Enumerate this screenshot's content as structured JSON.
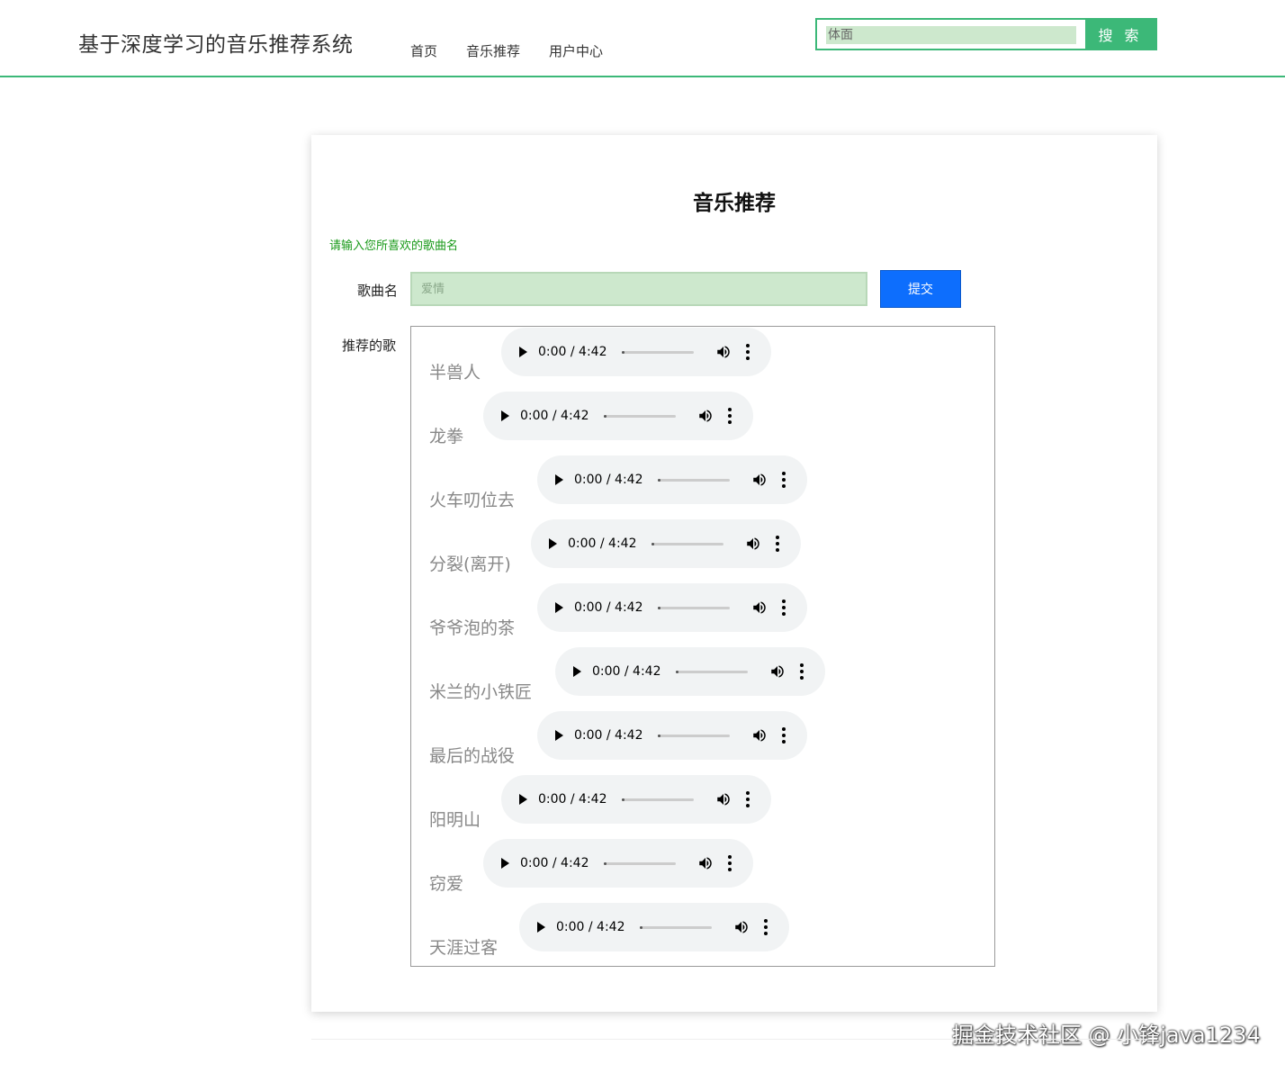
{
  "header": {
    "site_title": "基于深度学习的音乐推荐系统",
    "nav": [
      {
        "label": "首页"
      },
      {
        "label": "音乐推荐"
      },
      {
        "label": "用户中心"
      }
    ],
    "search": {
      "value": "",
      "placeholder": "体面",
      "button_label": "搜 索"
    }
  },
  "main": {
    "title": "音乐推荐",
    "hint": "请输入您所喜欢的歌曲名",
    "song_label": "歌曲名",
    "song_input": {
      "value": "",
      "placeholder": "爱情"
    },
    "submit_label": "提交",
    "recommend_label": "推荐的歌",
    "songs": [
      {
        "name": "半兽人",
        "time": "0:00 / 4:42",
        "progress": 0
      },
      {
        "name": "龙拳",
        "time": "0:00 / 4:42",
        "progress": 0
      },
      {
        "name": "火车叨位去",
        "time": "0:00 / 4:42",
        "progress": 0
      },
      {
        "name": "分裂(离开)",
        "time": "0:00 / 4:42",
        "progress": 0
      },
      {
        "name": "爷爷泡的茶",
        "time": "0:00 / 4:42",
        "progress": 0
      },
      {
        "name": "米兰的小铁匠",
        "time": "0:00 / 4:42",
        "progress": 0
      },
      {
        "name": "最后的战役",
        "time": "0:00 / 4:42",
        "progress": 0
      },
      {
        "name": "阳明山",
        "time": "0:00 / 4:42",
        "progress": 0
      },
      {
        "name": "窃爱",
        "time": "0:00 / 4:42",
        "progress": 0
      },
      {
        "name": "天涯过客",
        "time": "0:00 / 4:42",
        "progress": 0
      }
    ]
  },
  "watermark": "掘金技术社区 @ 小锋java1234",
  "colors": {
    "accent": "#3cb878",
    "primary_button": "#0d6efd",
    "hint_text": "#1a9a1a",
    "input_bg": "#cde8cd"
  }
}
